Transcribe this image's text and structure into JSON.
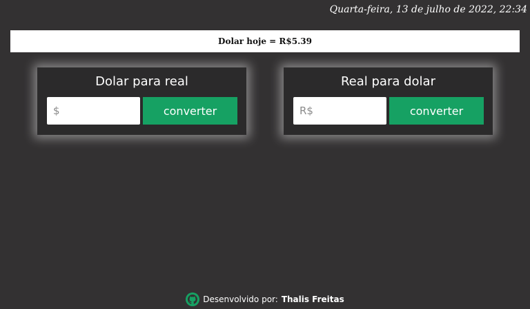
{
  "header": {
    "datetime": "Quarta-feira, 13 de julho de 2022, 22:34"
  },
  "rate": {
    "text": "Dolar hoje = R$5.39"
  },
  "cards": [
    {
      "title": "Dolar para real",
      "input_placeholder": "$",
      "input_value": "",
      "button_label": "converter"
    },
    {
      "title": "Real para dolar",
      "input_placeholder": "R$",
      "input_value": "",
      "button_label": "converter"
    }
  ],
  "footer": {
    "prefix": "Desenvolvido por:",
    "author": "Thalis Freitas",
    "icon": "github-icon"
  },
  "colors": {
    "background": "#333132",
    "card": "#2b2a2b",
    "accent": "#16a163"
  }
}
